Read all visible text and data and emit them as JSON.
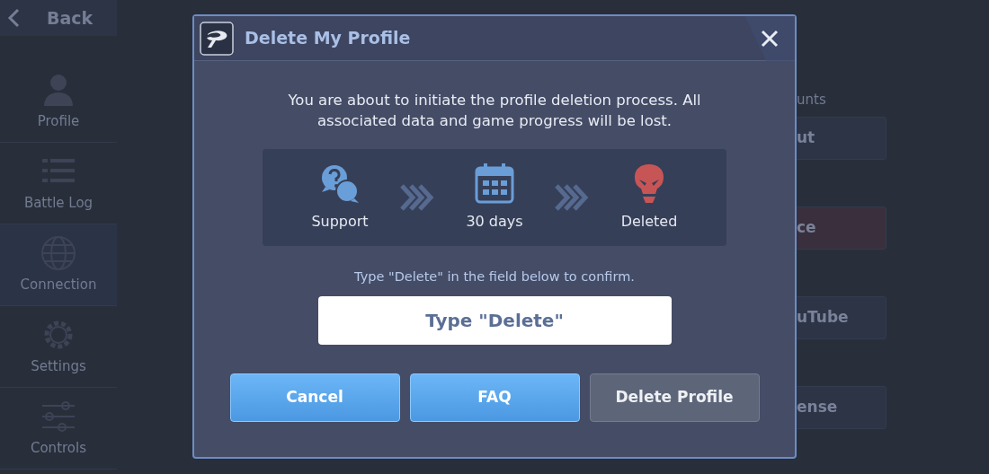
{
  "background": {
    "back_button": "Back",
    "sidebar": {
      "items": [
        {
          "label": "Profile",
          "kind": "person",
          "selected": false
        },
        {
          "label": "Battle Log",
          "kind": "list",
          "selected": false
        },
        {
          "label": "Connection",
          "kind": "globe",
          "selected": true
        },
        {
          "label": "Settings",
          "kind": "gear",
          "selected": false
        },
        {
          "label": "Controls",
          "kind": "sliders",
          "selected": false
        }
      ]
    },
    "panel": {
      "heading": "unts",
      "buttons": [
        {
          "label": "ut",
          "kind": "normal"
        },
        {
          "label": "ce",
          "kind": "danger"
        },
        {
          "label": "uTube",
          "kind": "normal"
        },
        {
          "label": "ense",
          "kind": "normal"
        }
      ]
    }
  },
  "dialog": {
    "title": "Delete My Profile",
    "message": "You are about to initiate the profile deletion process. All associated data and game progress will be lost.",
    "steps": [
      {
        "label": "Support",
        "kind": "support"
      },
      {
        "label": "30 days",
        "kind": "calendar"
      },
      {
        "label": "Deleted",
        "kind": "skull"
      }
    ],
    "hint": "Type \"Delete\" in the field below to confirm.",
    "field": {
      "placeholder": "Type \"Delete\""
    },
    "buttons": [
      {
        "label": "Cancel",
        "disabled": false
      },
      {
        "label": "FAQ",
        "disabled": false
      },
      {
        "label": "Delete Profile",
        "disabled": true
      }
    ]
  }
}
